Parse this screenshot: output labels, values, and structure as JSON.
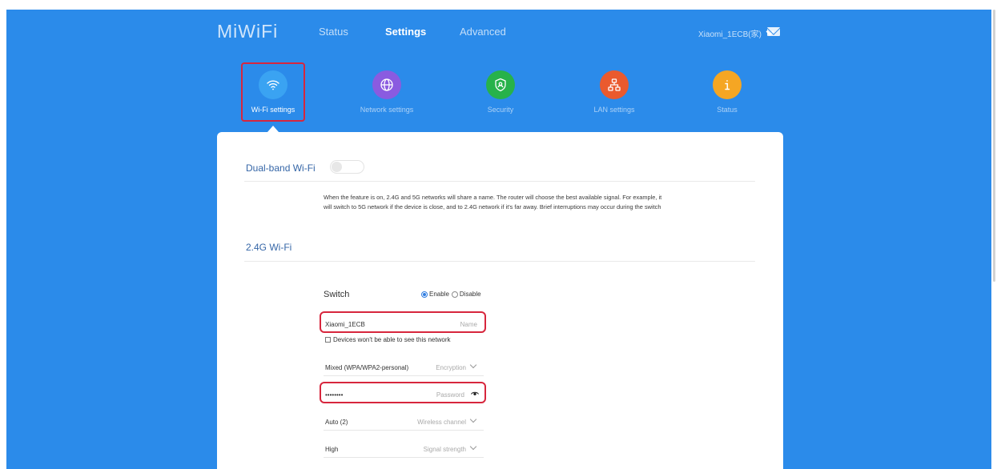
{
  "header": {
    "logo": "MiWiFi",
    "nav": [
      "Status",
      "Settings",
      "Advanced"
    ],
    "active_nav": "Settings",
    "account": "Xiaomi_1ECB(家)"
  },
  "categories": [
    {
      "label": "Wi-Fi settings",
      "icon": "wifi-icon",
      "color": "#3aa3f2",
      "active": true
    },
    {
      "label": "Network settings",
      "icon": "globe-icon",
      "color": "#8a5be0",
      "active": false
    },
    {
      "label": "Security",
      "icon": "shield-icon",
      "color": "#27b24a",
      "active": false
    },
    {
      "label": "LAN settings",
      "icon": "lan-icon",
      "color": "#ea5a2e",
      "active": false
    },
    {
      "label": "Status",
      "icon": "info-icon",
      "color": "#f5a623",
      "active": false
    }
  ],
  "dual_band": {
    "title": "Dual-band Wi-Fi",
    "enabled": false,
    "desc_line1": "When the feature is on, 2.4G and 5G networks will share a name. The router will choose the best available signal. For example, it",
    "desc_line2": "will switch to 5G network if the device is close, and to 2.4G network if it's far away. Brief interruptions may occur during the switch"
  },
  "wifi_24": {
    "title": "2.4G Wi-Fi",
    "switch_label": "Switch",
    "enable_label": "Enable",
    "disable_label": "Disable",
    "enabled": true,
    "name_value": "Xiaomi_1ECB",
    "name_placeholder": "Name",
    "hidden_label": "Devices won't be able to see this network",
    "encryption_value": "Mixed (WPA/WPA2-personal)",
    "encryption_label": "Encryption",
    "password_value": "••••••••",
    "password_label": "Password",
    "channel_value": "Auto (2)",
    "channel_label": "Wireless channel",
    "strength_value": "High",
    "strength_label": "Signal strength"
  },
  "colors": {
    "background": "#2b8bea",
    "highlight": "#d7263d",
    "section_title": "#3566a7"
  }
}
